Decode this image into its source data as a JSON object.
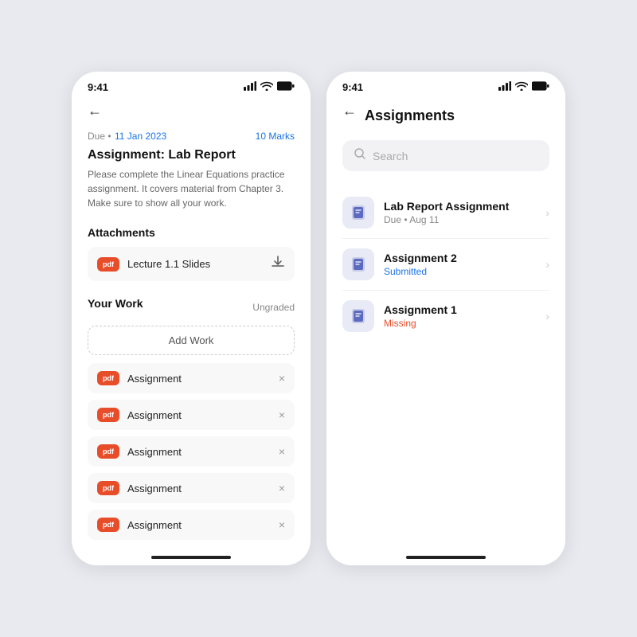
{
  "left_phone": {
    "status_time": "9:41",
    "due_label": "Due •",
    "due_date": "11 Jan 2023",
    "marks": "10 Marks",
    "assignment_title": "Assignment: Lab Report",
    "assignment_desc": "Please complete the Linear Equations practice assignment. It covers material from Chapter 3. Make sure to show all your work.",
    "attachments_label": "Attachments",
    "attachment_name": "Lecture 1.1 Slides",
    "attachment_type": "pdf",
    "your_work_label": "Your Work",
    "grade_status": "Ungraded",
    "add_work_label": "Add Work",
    "work_items": [
      {
        "label": "Assignment",
        "type": "pdf"
      },
      {
        "label": "Assignment",
        "type": "pdf"
      },
      {
        "label": "Assignment",
        "type": "pdf"
      },
      {
        "label": "Assignment",
        "type": "pdf"
      },
      {
        "label": "Assignment",
        "type": "pdf"
      }
    ]
  },
  "right_phone": {
    "status_time": "9:41",
    "page_title": "Assignments",
    "search_placeholder": "Search",
    "assignments": [
      {
        "title": "Lab Report Assignment",
        "sub": "Due • Aug 11",
        "sub_type": "due"
      },
      {
        "title": "Assignment 2",
        "sub": "Submitted",
        "sub_type": "submitted"
      },
      {
        "title": "Assignment 1",
        "sub": "Missing",
        "sub_type": "missing"
      }
    ]
  },
  "icons": {
    "back_arrow": "←",
    "download": "⬇",
    "close": "×",
    "chevron": "›",
    "search": "○",
    "book": "📖",
    "signal": "▲▲▲",
    "wifi": "wifi",
    "battery": "▮▮▮"
  }
}
